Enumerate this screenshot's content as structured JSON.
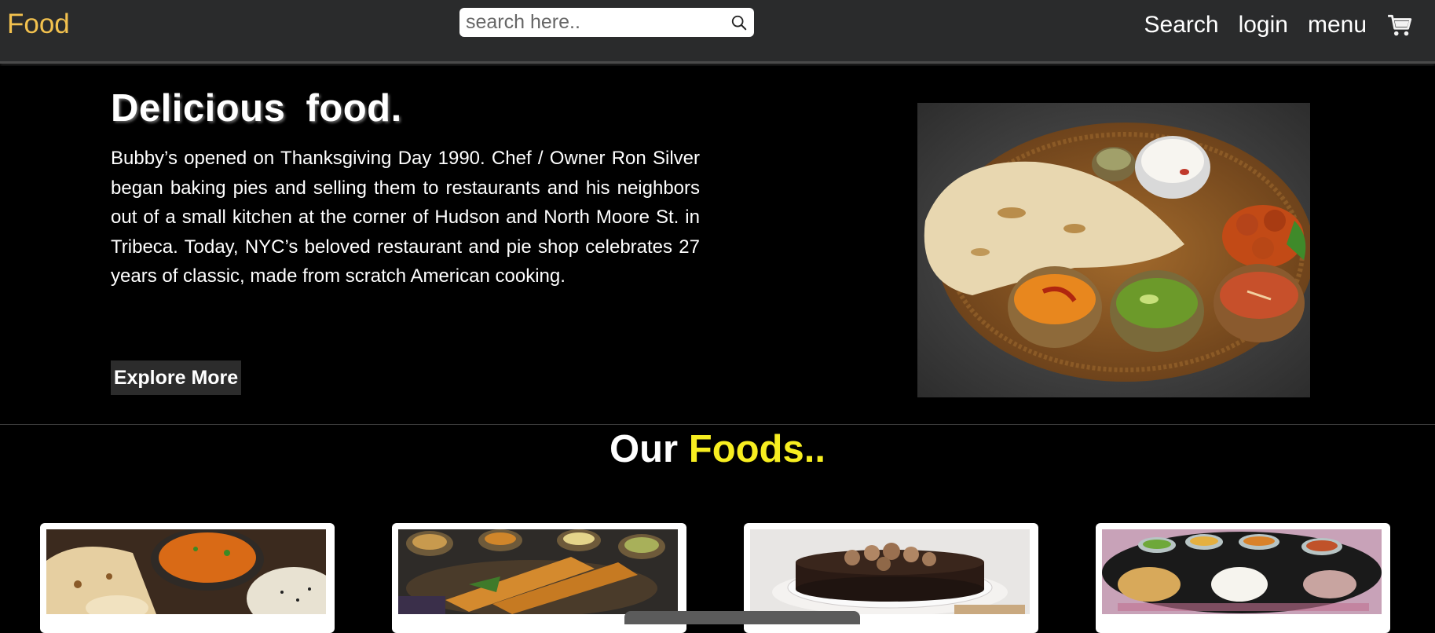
{
  "nav": {
    "brand": "Food",
    "search_placeholder": "search here..",
    "links": [
      "Search",
      "login",
      "menu"
    ],
    "search_icon": "magnifier-icon",
    "cart_icon": "shopping-cart-icon"
  },
  "hero": {
    "title": "Delicious  food.",
    "text": "Bubby’s opened on Thanksgiving Day 1990. Chef / Owner Ron Silver began baking pies and selling them to restaurants and his neighbors out of a small kitchen at the corner of Hudson and North Moore St. in Tribeca. Today, NYC’s beloved restaurant and pie shop celebrates 27 years of classic, made from scratch American cooking.",
    "button": "Explore More"
  },
  "section": {
    "title_plain": "Our",
    "title_accent": "Foods.."
  },
  "colors": {
    "brand": "#f2c14e",
    "accent": "#f7ee20",
    "nav_bg": "#2a2b2c",
    "page_bg": "#000000"
  }
}
